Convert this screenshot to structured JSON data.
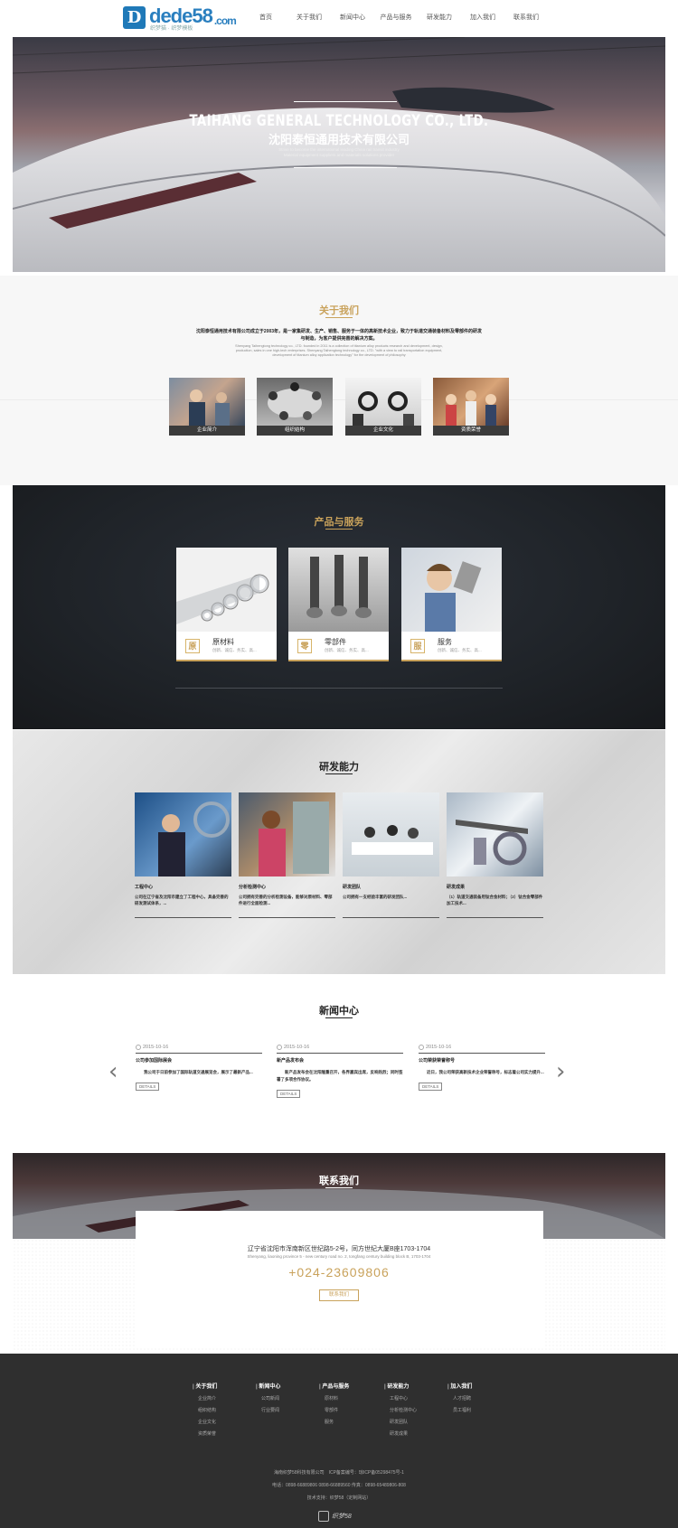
{
  "header": {
    "logo_text": "dede58",
    "logo_domain": ".com",
    "logo_sub": "织梦猫 · 织梦模板",
    "nav": [
      "首页",
      "关于我们",
      "新闻中心",
      "产品与服务",
      "研发能力",
      "加入我们",
      "联系我们"
    ]
  },
  "hero": {
    "title_en": "TAIHANG GENERAL TECHNOLOGY CO., LTD.",
    "title_cn": "沈阳泰恒通用技术有限公司",
    "tagline1": "Strive to become the international leading China rail transit industry",
    "tagline2": "Material equipment suppliers and materials solutions provider"
  },
  "about": {
    "title": "关于我们",
    "text_cn": "沈阳泰恒通用技术有限公司成立于2003年，是一家集研发、生产、销售、服务于一体的高新技术企业，致力于轨道交通装备材料及零部件的研发与制造，为客户提供完善的解决方案。",
    "text_en": "Shenyang Taihengtong technology co., LTD. founded in 2011 is a collection of titanium alloy products research and development, design, production, sales in one high-tech enterprises. Shenyang Taihengtong technology co., LTD. \"with a view to rail transportation equipment, development of titanium alloy application technology\" for the development of philosophy",
    "cards": [
      "企业简介",
      "组织结构",
      "企业文化",
      "资质荣誉"
    ],
    "accent": "#c9a25b"
  },
  "products": {
    "title": "产品与服务",
    "items": [
      {
        "name": "原材料",
        "desc": "创新、诚信、务实、高...",
        "icon": "原"
      },
      {
        "name": "零部件",
        "desc": "创新、诚信、务实、高...",
        "icon": "零"
      },
      {
        "name": "服务",
        "desc": "创新、诚信、务实、高...",
        "icon": "服"
      }
    ]
  },
  "research": {
    "title": "研发能力",
    "items": [
      {
        "title": "工程中心",
        "desc": "公司在辽宁省及沈阳市建立了工程中心，具备完善的研发测试体系，..."
      },
      {
        "title": "分析检测中心",
        "desc": "公司拥有完善的分析检测设备，能够对原材料、零部件进行全面检测..."
      },
      {
        "title": "研发团队",
        "desc": "公司拥有一支经验丰富的研发团队..."
      },
      {
        "title": "研发成果",
        "desc": "（1）轨道交通装备用钛合金材料；（2）钛合金零部件加工技术..."
      }
    ]
  },
  "news": {
    "title": "新闻中心",
    "items": [
      {
        "date": "2015-10-16",
        "title": "公司参加国际展会",
        "desc": "　　我公司于日前参加了国际轨道交通展览会，展示了最新产品...",
        "btn": "DETAILS"
      },
      {
        "date": "2015-10-16",
        "title": "新产品发布会",
        "desc": "　　新产品发布会在沈阳隆重召开，各界嘉宾出席，反响热烈；同时签署了多项合作协议。",
        "btn": "DETAILS"
      },
      {
        "date": "2015-10-16",
        "title": "公司荣获荣誉称号",
        "desc": "　　近日，我公司荣获高新技术企业荣誉称号，标志着公司实力提升...",
        "btn": "DETAILS"
      }
    ]
  },
  "contact": {
    "title": "联系我们",
    "address_cn": "辽宁省沈阳市浑南新区世纪路5-2号，同方世纪大厦B座1703-1704",
    "address_en": "Shenyang, liaoning province 5 - new century road no. 2, tongfang century building block B, 1703-1704",
    "phone": "+024-23609806",
    "button": "联系我们"
  },
  "footer": {
    "columns": [
      {
        "title": "关于我们",
        "items": [
          "企业简介",
          "组织结构",
          "企业文化",
          "资质荣誉"
        ]
      },
      {
        "title": "新闻中心",
        "items": [
          "公司新闻",
          "行业要闻"
        ]
      },
      {
        "title": "产品与服务",
        "items": [
          "原材料",
          "零部件",
          "服务"
        ]
      },
      {
        "title": "研发能力",
        "items": [
          "工程中心",
          "分析检测中心",
          "研发团队",
          "研发成果"
        ]
      },
      {
        "title": "加入我们",
        "items": [
          "人才招聘",
          "员工福利"
        ]
      }
    ],
    "copyright": "海南织梦58科技有限公司　ICP备案编号：琼ICP备05298475号-1",
    "phone_line": "电话：0898-66889806 0898-66889560 传真：0898-65489806-808",
    "support": "技术支持：织梦58（定制网站）",
    "logo_text": "织梦58"
  }
}
